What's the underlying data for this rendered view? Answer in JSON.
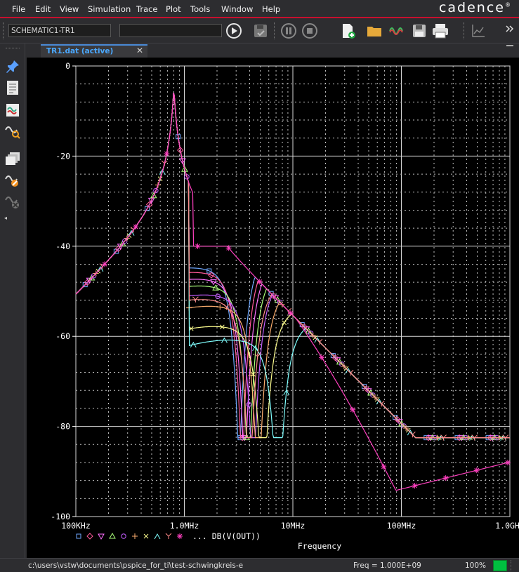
{
  "menubar": {
    "items": [
      "File",
      "Edit",
      "View",
      "Simulation",
      "Trace",
      "Plot",
      "Tools",
      "Window",
      "Help"
    ],
    "brand": "cadence",
    "brand_mark": "®"
  },
  "toolbar": {
    "schematic_value": "SCHEMATIC1-TR1",
    "profile_value": ""
  },
  "tab": {
    "label": "TR1.dat (active)",
    "close": "✕"
  },
  "status": {
    "path": "c:\\users\\vstw\\documents\\pspice_for_ti\\test-schwingkreis-e",
    "freq": "Freq =  1.000E+09",
    "zoom": "100%"
  },
  "chart_data": {
    "type": "line",
    "x_scale": "log",
    "xlim": [
      100000,
      1000000000
    ],
    "ylim": [
      -100,
      0
    ],
    "xlabel": "Frequency",
    "x_ticks": [
      {
        "value": 100000,
        "label": "100KHz"
      },
      {
        "value": 1000000,
        "label": "1.0MHz"
      },
      {
        "value": 10000000,
        "label": "10MHz"
      },
      {
        "value": 100000000,
        "label": "100MHz"
      },
      {
        "value": 1000000000,
        "label": "1.0GHz"
      }
    ],
    "y_ticks": [
      {
        "value": 0,
        "label": "0"
      },
      {
        "value": -20,
        "label": "-20"
      },
      {
        "value": -40,
        "label": "-40"
      },
      {
        "value": -60,
        "label": "-60"
      },
      {
        "value": -80,
        "label": "-80"
      },
      {
        "value": -100,
        "label": "-100"
      }
    ],
    "grid": true,
    "legend_text": "... DB(V(OUT))",
    "series": [
      {
        "marker": "square",
        "color": "#6fa8ff",
        "notch": 3200000.0,
        "peak_db": -39
      },
      {
        "marker": "diamond",
        "color": "#ff5a9a",
        "notch": 3400000.0,
        "peak_db": -40
      },
      {
        "marker": "triangle-down",
        "color": "#ff6fff",
        "notch": 3600000.0,
        "peak_db": -41.5
      },
      {
        "marker": "triangle-up",
        "color": "#aaff7a",
        "notch": 3900000.0,
        "peak_db": -43
      },
      {
        "marker": "circle",
        "color": "#c45dff",
        "notch": 4300000.0,
        "peak_db": -45
      },
      {
        "marker": "plus",
        "color": "#ffb070",
        "notch": 4800000.0,
        "peak_db": -47.5
      },
      {
        "marker": "cross",
        "color": "#ffff90",
        "notch": 5300000.0,
        "peak_db": -52
      },
      {
        "marker": "lambda",
        "color": "#80ffff",
        "notch": 7300000.0,
        "peak_db": -55
      },
      {
        "marker": "y",
        "color": "#ff8a8a",
        "notch": 4000000.0,
        "peak_db": -46
      },
      {
        "marker": "asterisk",
        "color": "#ff40c0",
        "notch": null,
        "peak_db": null
      }
    ],
    "resonance": {
      "freq": 800000.0,
      "peak_db": -4.5
    }
  }
}
